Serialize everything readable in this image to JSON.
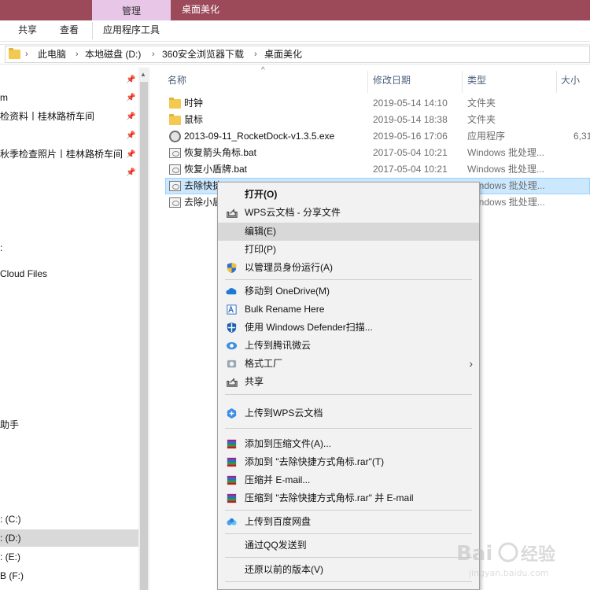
{
  "titlebar": {
    "context_tab": "管理",
    "window_title": "桌面美化"
  },
  "ribbon": {
    "tabs": [
      "共享",
      "查看",
      "应用程序工具"
    ]
  },
  "address": {
    "crumbs": [
      "此电脑",
      "本地磁盘 (D:)",
      "360安全浏览器下载",
      "桌面美化"
    ]
  },
  "nav": {
    "items": [
      "m",
      "检资料丨桂林路桥车间",
      "",
      "秋季检查照片丨桂林路桥车间",
      "",
      ":",
      "Cloud Files",
      "助手",
      ": (C:)",
      ": (D:)",
      ": (E:)",
      "B (F:)"
    ]
  },
  "columns": {
    "name": "名称",
    "date": "修改日期",
    "type": "类型",
    "size": "大小"
  },
  "files": [
    {
      "name": "时钟",
      "date": "2019-05-14 14:10",
      "type": "文件夹",
      "size": ""
    },
    {
      "name": "鼠标",
      "date": "2019-05-14 18:38",
      "type": "文件夹",
      "size": ""
    },
    {
      "name": "2013-09-11_RocketDock-v1.3.5.exe",
      "date": "2019-05-16 17:06",
      "type": "应用程序",
      "size": "6,31"
    },
    {
      "name": "恢复箭头角标.bat",
      "date": "2017-05-04 10:21",
      "type": "Windows 批处理...",
      "size": ""
    },
    {
      "name": "恢复小盾牌.bat",
      "date": "2017-05-04 10:21",
      "type": "Windows 批处理...",
      "size": ""
    },
    {
      "name": "去除快捷",
      "date": "",
      "type": "indows 批处理...",
      "size": ""
    },
    {
      "name": "去除小盾",
      "date": "",
      "type": "indows 批处理...",
      "size": ""
    }
  ],
  "menu": {
    "items": [
      {
        "label": "打开(O)",
        "icon": "none"
      },
      {
        "label": "WPS云文档 - 分享文件",
        "icon": "share-icon"
      },
      {
        "label": "编辑(E)",
        "icon": "none"
      },
      {
        "label": "打印(P)",
        "icon": "none"
      },
      {
        "label": "以管理员身份运行(A)",
        "icon": "uac-shield-icon"
      },
      {
        "label": "移动到 OneDrive(M)",
        "icon": "onedrive-icon"
      },
      {
        "label": "Bulk Rename Here",
        "icon": "bulk-rename-icon"
      },
      {
        "label": "使用 Windows Defender扫描...",
        "icon": "defender-icon"
      },
      {
        "label": "上传到腾讯微云",
        "icon": "weiyun-icon"
      },
      {
        "label": "格式工厂",
        "icon": "format-factory-icon"
      },
      {
        "label": "共享",
        "icon": "share-icon"
      },
      {
        "label": "上传到WPS云文档",
        "icon": "wps-cloud-icon"
      },
      {
        "label": "添加到压缩文件(A)...",
        "icon": "winrar-icon"
      },
      {
        "label": "添加到 \"去除快捷方式角标.rar\"(T)",
        "icon": "winrar-icon"
      },
      {
        "label": "压缩并 E-mail...",
        "icon": "winrar-icon"
      },
      {
        "label": "压缩到 \"去除快捷方式角标.rar\" 并 E-mail",
        "icon": "winrar-icon"
      },
      {
        "label": "上传到百度网盘",
        "icon": "baidu-netdisk-icon"
      },
      {
        "label": "通过QQ发送到",
        "icon": "none"
      },
      {
        "label": "还原以前的版本(V)",
        "icon": "none"
      }
    ]
  },
  "colors": {
    "titlebar": "#9c4a5a",
    "context_tab": "#e8c6e8",
    "selection": "#cce8ff",
    "menu_bg": "#f2f2f2",
    "menu_highlight": "#d8d8d8"
  }
}
